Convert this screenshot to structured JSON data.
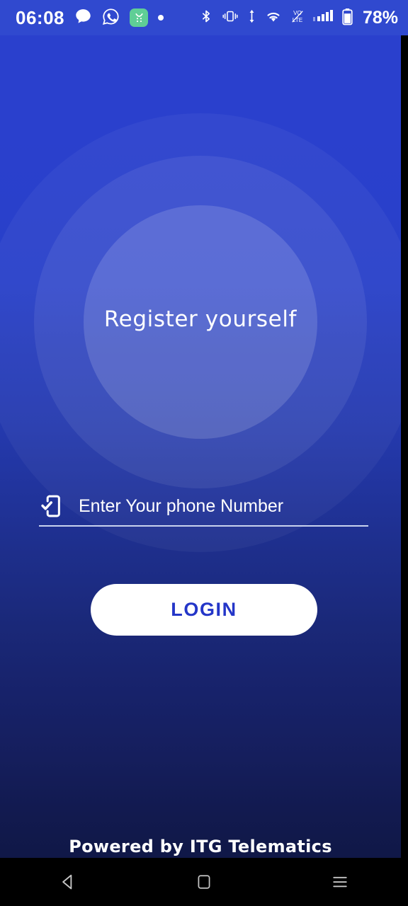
{
  "status_bar": {
    "clock": "06:08",
    "battery_percent": "78%",
    "left_icons": [
      {
        "name": "messages-icon",
        "glyph": "speech-bubble"
      },
      {
        "name": "whatsapp-icon",
        "glyph": "whatsapp"
      },
      {
        "name": "green-app-icon",
        "glyph": "green-square-app"
      },
      {
        "name": "notification-dot-icon",
        "glyph": "dot"
      }
    ],
    "right_icons": [
      {
        "name": "bluetooth-icon",
        "glyph": "bluetooth"
      },
      {
        "name": "vibrate-icon",
        "glyph": "vibrate"
      },
      {
        "name": "data-transfer-icon",
        "glyph": "up-down-arrows"
      },
      {
        "name": "wifi-icon",
        "glyph": "wifi"
      },
      {
        "name": "volte-icon",
        "glyph": "vo-lte"
      },
      {
        "name": "signal-icon",
        "glyph": "signal-bars"
      },
      {
        "name": "battery-icon",
        "glyph": "battery"
      }
    ]
  },
  "main": {
    "register_title": "Register yourself",
    "phone_input": {
      "placeholder": "Enter Your phone Number",
      "value": "",
      "icon": "phone-check-icon"
    },
    "login_label": "LOGIN",
    "footer_credit": "Powered by ITG Telematics"
  },
  "nav_bar": {
    "back_label": "Back",
    "home_label": "Home",
    "recents_label": "Recents"
  },
  "colors": {
    "background_top": "#2a40cd",
    "background_bottom": "#101847",
    "status_bar": "#3049cf",
    "login_button_bg": "#ffffff",
    "login_text": "#2436c8",
    "text_white": "#ffffff",
    "green_app": "#5fce96",
    "nav_bar": "#000000"
  }
}
